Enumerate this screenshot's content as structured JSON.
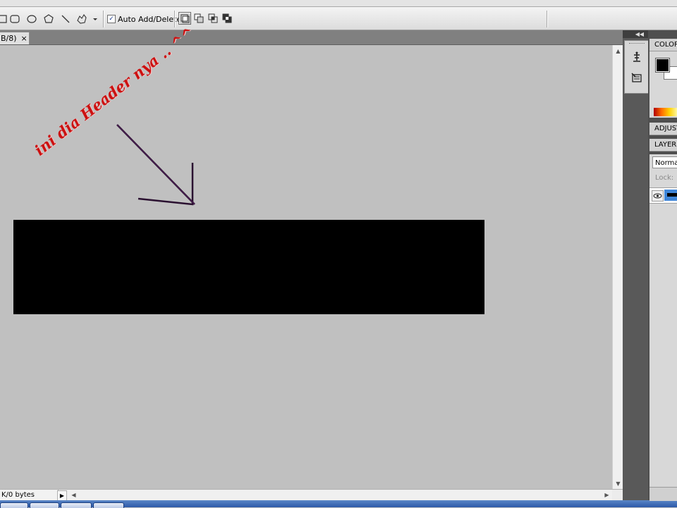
{
  "options_bar": {
    "auto_add_delete_label": "Auto Add/Delete",
    "auto_add_delete_checked": true,
    "tools": [
      "rectangle-tool",
      "rounded-rectangle-tool",
      "ellipse-tool",
      "polygon-tool",
      "line-tool",
      "custom-shape-tool"
    ],
    "path_modes": [
      "add-to-path-area",
      "subtract-from-path-area",
      "intersect-path-areas",
      "exclude-overlapping-path-areas"
    ]
  },
  "document": {
    "tab_label": "B/8)",
    "tab_close": "×"
  },
  "canvas": {
    "background": "#c0c0c0",
    "annotation_text": "ini dia Header nya .. ^^",
    "annotation_color": "#cc1111",
    "arrow_color": "#2a1030",
    "header_block_color": "#000000"
  },
  "status_bar": {
    "doc_info": "K/0 bytes",
    "menu_arrow": "▶"
  },
  "panels": {
    "color_title": "COLOR",
    "foreground_color": "#000000",
    "background_color": "#ffffff",
    "adjustments_title": "ADJUST",
    "layers_title": "LAYERS",
    "blend_mode": "Normal",
    "lock_label": "Lock:"
  }
}
